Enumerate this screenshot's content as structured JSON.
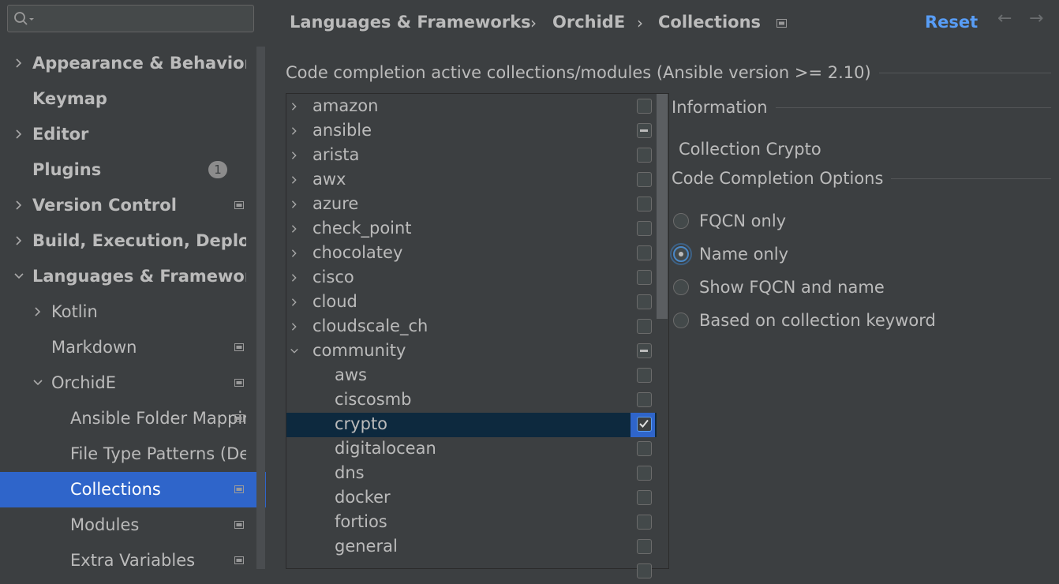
{
  "sidebar": {
    "search": {
      "value": "",
      "placeholder": ""
    },
    "items": [
      {
        "label": "Appearance & Behavior",
        "expander": "collapsed",
        "bold": true,
        "badge": null,
        "project_icon": false,
        "selected": false
      },
      {
        "label": "Keymap",
        "expander": "none",
        "bold": true,
        "badge": null,
        "project_icon": false,
        "selected": false
      },
      {
        "label": "Editor",
        "expander": "collapsed",
        "bold": true,
        "badge": null,
        "project_icon": false,
        "selected": false
      },
      {
        "label": "Plugins",
        "expander": "none",
        "bold": true,
        "badge": "1",
        "project_icon": false,
        "selected": false
      },
      {
        "label": "Version Control",
        "expander": "collapsed",
        "bold": true,
        "badge": null,
        "project_icon": true,
        "selected": false
      },
      {
        "label": "Build, Execution, Deployment",
        "expander": "collapsed",
        "bold": true,
        "badge": null,
        "project_icon": false,
        "selected": false
      },
      {
        "label": "Languages & Frameworks",
        "expander": "expanded",
        "bold": true,
        "badge": null,
        "project_icon": false,
        "selected": false
      },
      {
        "label": "Kotlin",
        "expander": "collapsed",
        "bold": false,
        "badge": null,
        "project_icon": false,
        "selected": false
      },
      {
        "label": "Markdown",
        "expander": "none",
        "bold": false,
        "badge": null,
        "project_icon": true,
        "selected": false
      },
      {
        "label": "OrchidE",
        "expander": "expanded",
        "bold": false,
        "badge": null,
        "project_icon": true,
        "selected": false
      },
      {
        "label": "Ansible Folder Mappings",
        "expander": "none",
        "bold": false,
        "badge": null,
        "project_icon": true,
        "selected": false
      },
      {
        "label": "File Type Patterns (Deprecated)",
        "expander": "none",
        "bold": false,
        "badge": null,
        "project_icon": false,
        "selected": false
      },
      {
        "label": "Collections",
        "expander": "none",
        "bold": false,
        "badge": null,
        "project_icon": true,
        "selected": true
      },
      {
        "label": "Modules",
        "expander": "none",
        "bold": false,
        "badge": null,
        "project_icon": true,
        "selected": false
      },
      {
        "label": "Extra Variables",
        "expander": "none",
        "bold": false,
        "badge": null,
        "project_icon": true,
        "selected": false
      }
    ]
  },
  "header": {
    "breadcrumbs": [
      "Languages & Frameworks",
      "OrchidE",
      "Collections"
    ],
    "reset_label": "Reset",
    "back_arrow": "←",
    "forward_arrow": "→"
  },
  "main": {
    "collections_title": "Code completion active collections/modules (Ansible version >= 2.10)",
    "tree": [
      {
        "label": "amazon",
        "expander": "collapsed",
        "state": "unchecked",
        "selected": false
      },
      {
        "label": "ansible",
        "expander": "collapsed",
        "state": "partial",
        "selected": false
      },
      {
        "label": "arista",
        "expander": "collapsed",
        "state": "unchecked",
        "selected": false
      },
      {
        "label": "awx",
        "expander": "collapsed",
        "state": "unchecked",
        "selected": false
      },
      {
        "label": "azure",
        "expander": "collapsed",
        "state": "unchecked",
        "selected": false
      },
      {
        "label": "check_point",
        "expander": "collapsed",
        "state": "unchecked",
        "selected": false
      },
      {
        "label": "chocolatey",
        "expander": "collapsed",
        "state": "unchecked",
        "selected": false
      },
      {
        "label": "cisco",
        "expander": "collapsed",
        "state": "unchecked",
        "selected": false
      },
      {
        "label": "cloud",
        "expander": "collapsed",
        "state": "unchecked",
        "selected": false
      },
      {
        "label": "cloudscale_ch",
        "expander": "collapsed",
        "state": "unchecked",
        "selected": false
      },
      {
        "label": "community",
        "expander": "expanded",
        "state": "partial",
        "selected": false
      },
      {
        "label": "aws",
        "expander": "child",
        "state": "unchecked",
        "selected": false
      },
      {
        "label": "ciscosmb",
        "expander": "child",
        "state": "unchecked",
        "selected": false
      },
      {
        "label": "crypto",
        "expander": "child",
        "state": "checked",
        "selected": true
      },
      {
        "label": "digitalocean",
        "expander": "child",
        "state": "unchecked",
        "selected": false
      },
      {
        "label": "dns",
        "expander": "child",
        "state": "unchecked",
        "selected": false
      },
      {
        "label": "docker",
        "expander": "child",
        "state": "unchecked",
        "selected": false
      },
      {
        "label": "fortios",
        "expander": "child",
        "state": "unchecked",
        "selected": false
      },
      {
        "label": "general",
        "expander": "child",
        "state": "unchecked",
        "selected": false
      },
      {
        "label": "",
        "expander": "child",
        "state": "unchecked",
        "selected": false
      }
    ],
    "information_title": "Information",
    "information_text": "Collection Crypto",
    "options_title": "Code Completion Options",
    "options": [
      {
        "label": "FQCN only",
        "selected": false
      },
      {
        "label": "Name only",
        "selected": true
      },
      {
        "label": "Show FQCN and name",
        "selected": false
      },
      {
        "label": "Based on collection keyword",
        "selected": false
      }
    ]
  },
  "colors": {
    "background": "#3c3f41",
    "selection": "#2f65ca",
    "tree_selection": "#0d293e",
    "link": "#589df6",
    "text": "#bbbbbb"
  },
  "icons": {
    "search": "search-icon",
    "project_scope": "project-scope-icon",
    "chevron_right": "chevron-right-icon",
    "chevron_down": "chevron-down-icon"
  }
}
